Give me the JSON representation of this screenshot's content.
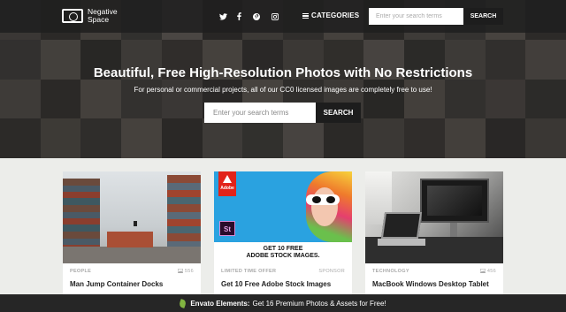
{
  "header": {
    "logo_line1": "Negative",
    "logo_line2": "Space",
    "social_icons": [
      "twitter-icon",
      "facebook-icon",
      "pinterest-icon",
      "instagram-icon"
    ],
    "categories_label": "CATEGORIES",
    "search_placeholder": "Enter your search terms",
    "search_button": "SEARCH"
  },
  "hero": {
    "title": "Beautiful, Free High-Resolution Photos with No Restrictions",
    "subtitle": "For personal or commercial projects, all of our CC0 licensed images are completely free to use!",
    "search_placeholder": "Enter your search terms",
    "search_button": "SEARCH"
  },
  "cards": [
    {
      "category": "PEOPLE",
      "right_text": "556",
      "title": "Man Jump Container Docks"
    },
    {
      "category": "LIMITED TIME OFFER",
      "right_text": "SPONSOR",
      "title": "Get 10 Free Adobe Stock Images",
      "ad_brand": "Adobe",
      "ad_app": "St",
      "ad_banner_line1": "GET 10 FREE",
      "ad_banner_line2": "ADOBE STOCK IMAGES."
    },
    {
      "category": "TECHNOLOGY",
      "right_text": "456",
      "title": "MacBook Windows Desktop Tablet"
    }
  ],
  "footer_banner": {
    "brand": "Envato Elements:",
    "text": "Get 16 Premium Photos & Assets for Free!"
  },
  "colors": {
    "topbar": "#1e1e1e",
    "button_dark": "#1d1d1d",
    "page_bg": "#ecedea",
    "envato_green": "#82b541"
  }
}
